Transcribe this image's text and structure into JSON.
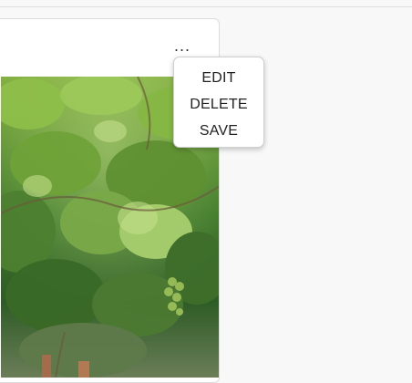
{
  "card": {
    "more_label": "...",
    "image": {
      "icon": "grapevine-photo",
      "alt": ""
    }
  },
  "menu": {
    "items": [
      {
        "label": "EDIT"
      },
      {
        "label": "DELETE"
      },
      {
        "label": "SAVE"
      }
    ]
  },
  "colors": {
    "page_bg": "#f8f8f8",
    "card_bg": "#ffffff",
    "border": "#dcdcdc",
    "menu_text": "#222222"
  }
}
